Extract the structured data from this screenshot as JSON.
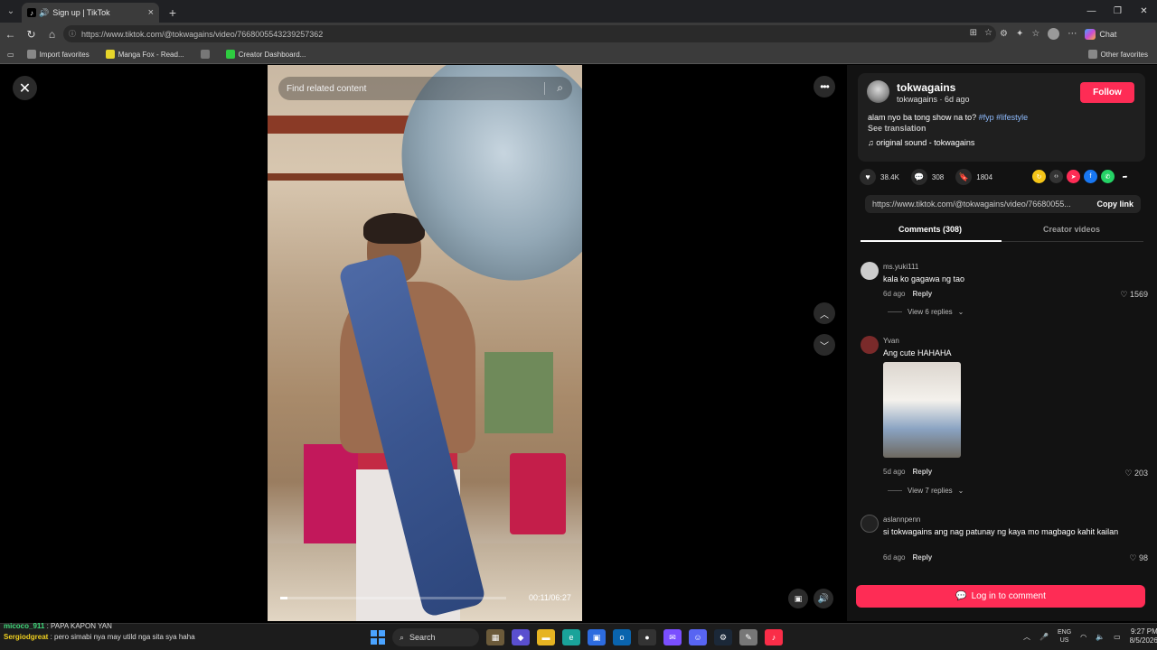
{
  "browser": {
    "tab_title": "Sign up | TikTok",
    "url": "https://www.tiktok.com/@tokwagains/video/7668005543239257362",
    "chat_label": "Chat",
    "favorites": [
      {
        "label": "Import favorites",
        "color": "#888888"
      },
      {
        "label": "Manga Fox - Read...",
        "color": "#e6d52a"
      },
      {
        "label": "",
        "color": "#777777"
      },
      {
        "label": "Creator Dashboard...",
        "color": "#2ecc40"
      }
    ],
    "other_favorites": "Other favorites"
  },
  "video": {
    "search_placeholder": "Find related content",
    "timecode": "00:11/06:27",
    "progress": 0.03
  },
  "author": {
    "name": "tokwagains",
    "sub": "tokwagains · 6d ago",
    "follow_label": "Follow",
    "caption_text": "alam nyo ba tong show na to? ",
    "caption_tags": "#fyp #lifestyle",
    "see_translation": "See translation",
    "music": "original sound - tokwagains"
  },
  "stats": {
    "likes": "38.4K",
    "comments": "308",
    "saves": "1804"
  },
  "share_link": {
    "url": "https://www.tiktok.com/@tokwagains/video/76680055...",
    "copy_label": "Copy link"
  },
  "tabs": {
    "comments": "Comments (308)",
    "creator": "Creator videos"
  },
  "comments": [
    {
      "user": "ms.yuki111",
      "text": "kala ko gagawa ng tao",
      "age": "6d ago",
      "reply": "Reply",
      "likes": "1569",
      "replies": "View 6 replies"
    },
    {
      "user": "Yvan",
      "text": "Ang cute HAHAHA",
      "age": "5d ago",
      "reply": "Reply",
      "likes": "203",
      "replies": "View 7 replies"
    },
    {
      "user": "aslannpenn",
      "text": "si tokwagains ang nag patunay ng kaya mo magbago kahit kailan",
      "age": "6d ago",
      "reply": "Reply",
      "likes": "98"
    }
  ],
  "login_label": "Log in to comment",
  "overlay_chat": [
    {
      "user": "micoco_911",
      "msg": " : PAPA KAPON YAN"
    },
    {
      "user": "Sergiodgreat",
      "msg": " : pero simabi nya may utild nga sita sya haha"
    }
  ],
  "taskbar": {
    "search_label": "Search",
    "lang": "ENG",
    "region": "US",
    "time": "9:27 PM",
    "date": "8/5/2026"
  }
}
